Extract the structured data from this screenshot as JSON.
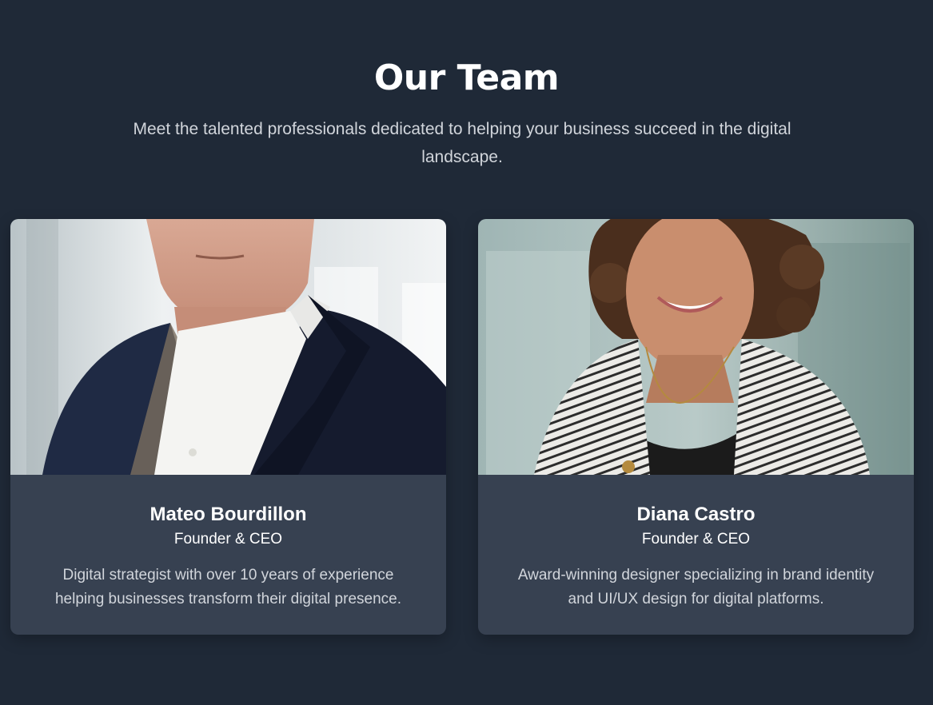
{
  "section": {
    "title": "Our Team",
    "subtitle": "Meet the talented professionals dedicated to helping your business succeed in the digital landscape."
  },
  "team": [
    {
      "name": "Mateo Bourdillon",
      "role": "Founder & CEO",
      "bio": "Digital strategist with over 10 years of experience helping businesses transform their digital presence.",
      "photo_icon": "portrait-photo"
    },
    {
      "name": "Diana Castro",
      "role": "Founder & CEO",
      "bio": "Award-winning designer specializing in brand identity and UI/UX design for digital platforms.",
      "photo_icon": "portrait-photo"
    }
  ],
  "colors": {
    "background": "#1f2937",
    "card": "#374151",
    "text": "#ffffff",
    "muted_text": "#d1d5db"
  }
}
